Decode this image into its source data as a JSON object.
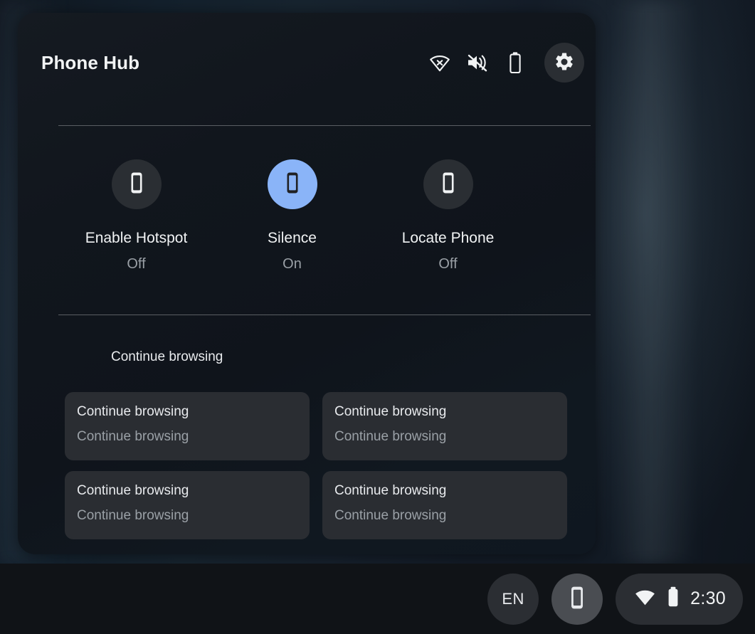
{
  "hub": {
    "title": "Phone Hub",
    "header_icons": [
      {
        "name": "wifi-off-icon",
        "label": "Wi-Fi off"
      },
      {
        "name": "volume-muted-icon",
        "label": "Volume muted"
      },
      {
        "name": "battery-empty-icon",
        "label": "Battery"
      }
    ],
    "settings_button": {
      "name": "gear-icon",
      "label": "Settings"
    },
    "quick_actions": [
      {
        "label": "Enable Hotspot",
        "state": "Off",
        "active": false,
        "icon": "phone-icon"
      },
      {
        "label": "Silence",
        "state": "On",
        "active": true,
        "icon": "phone-icon"
      },
      {
        "label": "Locate Phone",
        "state": "Off",
        "active": false,
        "icon": "phone-icon"
      }
    ],
    "browsing": {
      "section_title": "Continue browsing",
      "cards": [
        {
          "title": "Continue browsing",
          "subtitle": "Continue browsing"
        },
        {
          "title": "Continue browsing",
          "subtitle": "Continue browsing"
        },
        {
          "title": "Continue browsing",
          "subtitle": "Continue browsing"
        },
        {
          "title": "Continue browsing",
          "subtitle": "Continue browsing"
        }
      ]
    }
  },
  "shelf": {
    "language": "EN",
    "phone_tray": {
      "icon": "phone-icon",
      "label": "Phone Hub",
      "active": true
    },
    "status": {
      "wifi_icon": "wifi-icon",
      "battery_icon": "battery-icon",
      "time": "2:30"
    }
  },
  "colors": {
    "accent_active": "#8ab4f8",
    "panel_bg": "#11161d",
    "card_bg": "#2a2d32",
    "shelf_bg": "#101317",
    "text_primary": "#e8eaed",
    "text_secondary": "#9aa0a6"
  }
}
